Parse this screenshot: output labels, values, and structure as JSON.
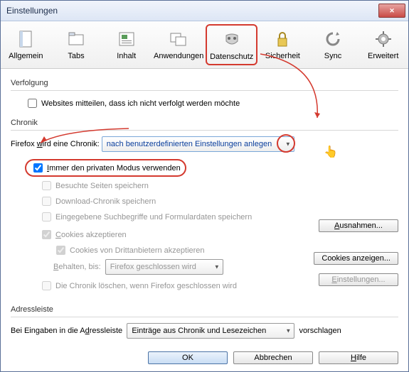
{
  "window": {
    "title": "Einstellungen",
    "close": "✕"
  },
  "toolbar": {
    "tabs": [
      {
        "label": "Allgemein"
      },
      {
        "label": "Tabs"
      },
      {
        "label": "Inhalt"
      },
      {
        "label": "Anwendungen"
      },
      {
        "label": "Datenschutz"
      },
      {
        "label": "Sicherheit"
      },
      {
        "label": "Sync"
      },
      {
        "label": "Erweitert"
      }
    ]
  },
  "tracking": {
    "title": "Verfolgung",
    "opt": "Websites mitteilen, dass ich nicht verfolgt werden möchte"
  },
  "history": {
    "title": "Chronik",
    "label": "Firefox wird eine Chronik:",
    "mode": "nach benutzerdefinierten Einstellungen anlegen",
    "private": "Immer den privaten Modus verwenden",
    "visited": "Besuchte Seiten speichern",
    "downloads": "Download-Chronik speichern",
    "forms": "Eingegebene Suchbegriffe und Formulardaten speichern",
    "cookies": "Cookies akzeptieren",
    "third": "Cookies von Drittanbietern akzeptieren",
    "keep_label": "Behalten, bis:",
    "keep_value": "Firefox geschlossen wird",
    "clear_close": "Die Chronik löschen, wenn Firefox geschlossen wird",
    "btn_exceptions": "Ausnahmen...",
    "btn_show": "Cookies anzeigen...",
    "btn_settings": "Einstellungen..."
  },
  "addressbar": {
    "title": "Adressleiste",
    "label": "Bei Eingaben in die Adressleiste",
    "value": "Einträge aus Chronik und Lesezeichen",
    "suffix": "vorschlagen"
  },
  "footer": {
    "ok": "OK",
    "cancel": "Abbrechen",
    "help": "Hilfe"
  }
}
